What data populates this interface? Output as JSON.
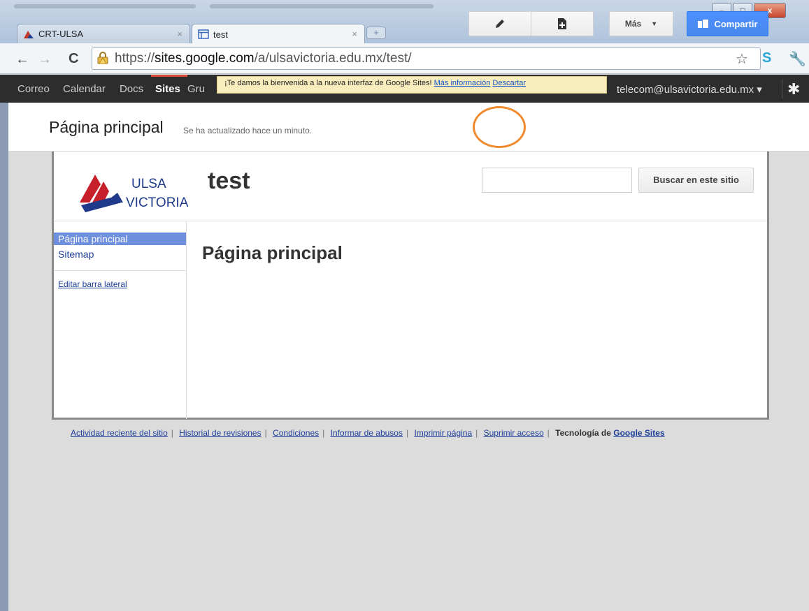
{
  "browser": {
    "tabs": [
      {
        "label": "CRT-ULSA",
        "close": "×"
      },
      {
        "label": "test",
        "close": "×"
      }
    ],
    "url": {
      "scheme": "https://",
      "host": "sites.google.com",
      "path": "/a/ulsavictoria.edu.mx/test/"
    },
    "window_controls": {
      "minimize": "–",
      "maximize": "□",
      "close": "x"
    }
  },
  "gbar": {
    "links": [
      "Correo",
      "Calendar",
      "Docs",
      "Sites",
      "Gru"
    ],
    "account": "telecom@ulsavictoria.edu.mx ▾"
  },
  "notice": {
    "text": "¡Te damos la bienvenida a la nueva interfaz de Google Sites!",
    "more_link": "Más información",
    "dismiss_link": "Descartar"
  },
  "sitesbar": {
    "page_title": "Página principal",
    "updated": "Se ha actualizado hace un minuto.",
    "more_label": "Más",
    "share_label": "Compartir"
  },
  "site": {
    "logo_line1": "ULSA",
    "logo_line2": "VICTORIA",
    "title": "test",
    "search_button": "Buscar en este sitio",
    "search_placeholder": ""
  },
  "sidebar": {
    "items": [
      {
        "label": "Página principal"
      },
      {
        "label": "Sitemap"
      }
    ],
    "edit_link": "Editar barra lateral"
  },
  "content": {
    "title": "Página principal"
  },
  "footer": {
    "links": [
      "Actividad reciente del sitio",
      "Historial de revisiones",
      "Condiciones",
      "Informar de abusos",
      "Imprimir página",
      "Suprimir acceso"
    ],
    "tech_text": "Tecnología de",
    "tech_link": "Google Sites"
  },
  "colors": {
    "accent_blue": "#4d90fe",
    "gbar_bg": "#2d2d2d",
    "highlight_orange": "#ef8a2e",
    "nav_selected": "#6d8fdd"
  }
}
